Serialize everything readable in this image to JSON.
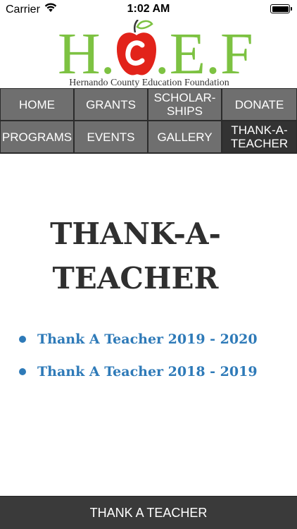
{
  "status_bar": {
    "carrier": "Carrier",
    "time": "1:02 AM",
    "icons": [
      "wifi-icon",
      "battery-icon"
    ]
  },
  "logo": {
    "letters": [
      "H",
      ".",
      "C",
      ".",
      "E",
      ".",
      "F"
    ],
    "subtitle": "Hernando County Education Foundation",
    "colors": {
      "letters": "#7dc242",
      "apple": "#e2231a",
      "leaf": "#7dc242"
    }
  },
  "nav": {
    "items": [
      {
        "label": "HOME",
        "active": false
      },
      {
        "label": "GRANTS",
        "active": false
      },
      {
        "label": "SCHOLAR-\nSHIPS",
        "active": false
      },
      {
        "label": "DONATE",
        "active": false
      },
      {
        "label": "PROGRAMS",
        "active": false
      },
      {
        "label": "EVENTS",
        "active": false
      },
      {
        "label": "GALLERY",
        "active": false
      },
      {
        "label": "THANK-A-\nTEACHER",
        "active": true
      }
    ],
    "colors": {
      "item_bg": "#6f6f6f",
      "active_bg": "#333333",
      "text": "#ffffff"
    }
  },
  "main": {
    "title": "THANK-A-\nTEACHER",
    "links": [
      {
        "label": "Thank A Teacher 2019 - 2020"
      },
      {
        "label": "Thank A Teacher 2018 - 2019"
      }
    ],
    "colors": {
      "title": "#2f2f2f",
      "link": "#2e7ab8"
    }
  },
  "bottom_bar": {
    "label": "THANK A TEACHER"
  }
}
